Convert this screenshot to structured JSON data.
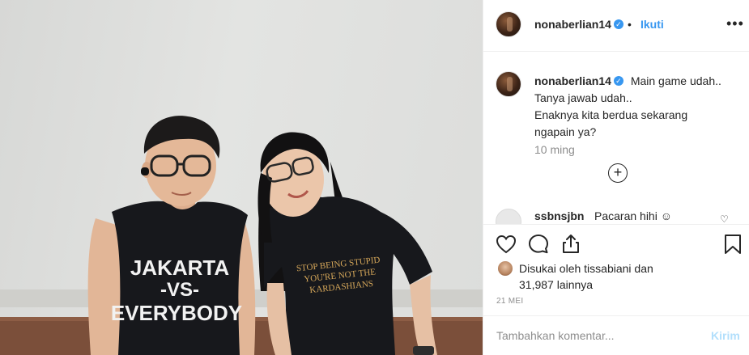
{
  "post": {
    "username": "nonaberlian14",
    "follow_label": "Ikuti",
    "dot_separator": "•",
    "more_label": "•••",
    "verified_glyph": "✓"
  },
  "photo": {
    "left_shirt_lines": [
      "JAKARTA",
      "-VS-",
      "EVERYBODY"
    ],
    "right_shirt_lines": [
      "STOP BEING STUPID",
      "YOU'RE NOT THE",
      "KARDASHIANS"
    ]
  },
  "caption": {
    "username": "nonaberlian14",
    "lines": [
      "Main game udah..",
      "Tanya jawab udah..",
      "Enaknya kita berdua sekarang",
      "ngapain ya?"
    ],
    "time_ago": "10 ming",
    "load_more_glyph": "+"
  },
  "comment": {
    "username": "ssbnsjbn",
    "text": "Pacaran hihi ☺"
  },
  "actions": {
    "icons": [
      "heart-icon",
      "comment-icon",
      "share-icon",
      "bookmark-icon"
    ]
  },
  "likes": {
    "line1": "Disukai oleh tissabiani dan",
    "line2": "31,987 lainnya"
  },
  "date": "21 MEI",
  "add_comment": {
    "placeholder": "Tambahkan komentar...",
    "post_label": "Kirim"
  },
  "colors": {
    "link_blue": "#3897f0",
    "muted_gray": "#8e8e8e",
    "disabled_blue": "#b2dffc"
  }
}
